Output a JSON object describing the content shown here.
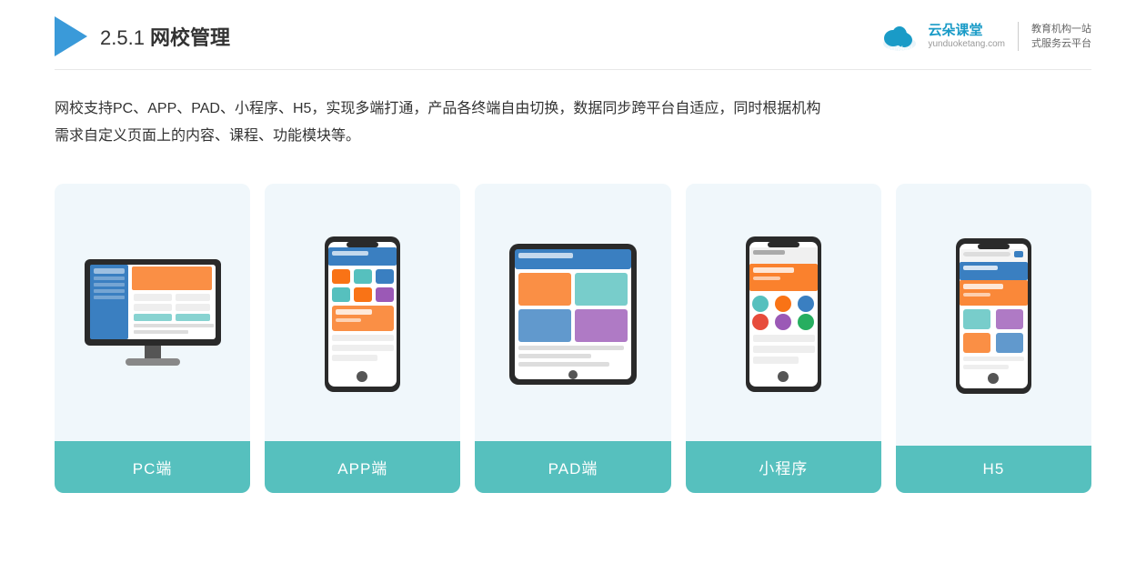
{
  "header": {
    "title_prefix": "2.5.1 ",
    "title_main": "网校管理",
    "logo_url": "yunduoketang.com",
    "logo_name": "云朵课堂",
    "logo_sub": "yunduoketang.com",
    "logo_slogan_line1": "教育机构一站",
    "logo_slogan_line2": "式服务云平台"
  },
  "description": {
    "text_line1": "网校支持PC、APP、PAD、小程序、H5，实现多端打通，产品各终端自由切换，数据同步跨平台自适应，同时根据机构",
    "text_line2": "需求自定义页面上的内容、课程、功能模块等。"
  },
  "cards": [
    {
      "id": "pc",
      "label": "PC端",
      "type": "pc"
    },
    {
      "id": "app",
      "label": "APP端",
      "type": "phone"
    },
    {
      "id": "pad",
      "label": "PAD端",
      "type": "tablet"
    },
    {
      "id": "miniapp",
      "label": "小程序",
      "type": "phone"
    },
    {
      "id": "h5",
      "label": "H5",
      "type": "phone"
    }
  ]
}
